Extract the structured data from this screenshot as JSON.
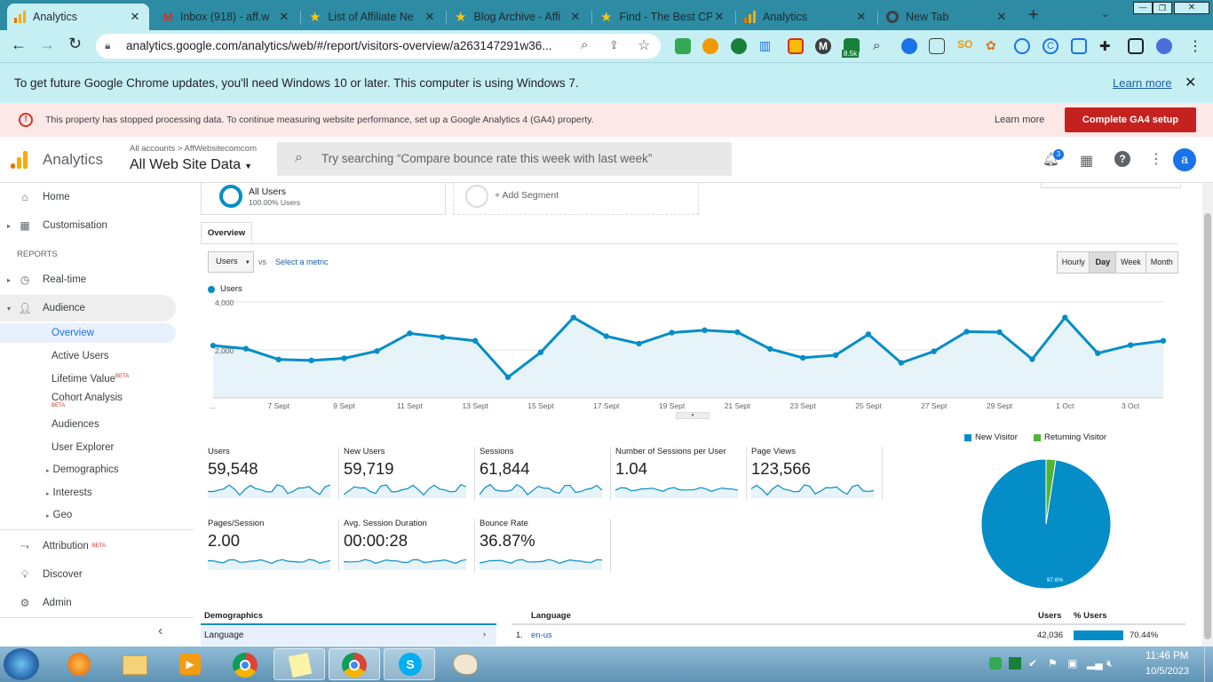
{
  "tabs": [
    {
      "title": "Analytics",
      "icon": "analytics-icon",
      "active": true
    },
    {
      "title": "Inbox (918) - aff.w",
      "icon": "gmail-icon"
    },
    {
      "title": "List of Affiliate Ne",
      "icon": "star-icon"
    },
    {
      "title": "Blog Archive - Affi",
      "icon": "star-icon"
    },
    {
      "title": "Find - The Best CP",
      "icon": "star-icon"
    },
    {
      "title": "Analytics",
      "icon": "analytics-icon"
    },
    {
      "title": "New Tab",
      "icon": "chrome-icon"
    }
  ],
  "tab_close": "✕",
  "new_tab": "+",
  "url": "analytics.google.com/analytics/web/#/report/visitors-overview/a263147291w36...",
  "ext_badge": "8.5k",
  "chrome_banner": {
    "text": "To get future Google Chrome updates, you'll need Windows 10 or later. This computer is using Windows 7.",
    "link": "Learn more",
    "close": "✕"
  },
  "ga_banner": {
    "text": "This property has stopped processing data. To continue measuring website performance, set up a Google Analytics 4 (GA4) property.",
    "learn": "Learn more",
    "cta": "Complete GA4 setup"
  },
  "header": {
    "product": "Analytics",
    "crumb": "All accounts > AffWebsitecomcom",
    "view": "All Web Site Data",
    "search_placeholder": "Try searching “Compare bounce rate this week with last week”",
    "notif_count": "3",
    "avatar": "a"
  },
  "sidebar": {
    "home": "Home",
    "customisation": "Customisation",
    "reports": "REPORTS",
    "realtime": "Real-time",
    "audience": "Audience",
    "sub": [
      "Overview",
      "Active Users",
      "Lifetime Value",
      "Cohort Analysis",
      "Audiences",
      "User Explorer",
      "Demographics",
      "Interests",
      "Geo"
    ],
    "beta": "BETA",
    "attribution": "Attribution",
    "discover": "Discover",
    "admin": "Admin",
    "collapse": "‹"
  },
  "segments": {
    "all_users": "All Users",
    "all_users_pct": "100.00% Users",
    "add": "+ Add Segment"
  },
  "overview_tab": "Overview",
  "metric_select": "Users",
  "vs": "vs",
  "select_metric": "Select a metric",
  "granularity": [
    "Hourly",
    "Day",
    "Week",
    "Month"
  ],
  "legend": "Users",
  "metrics": [
    {
      "label": "Users",
      "value": "59,548"
    },
    {
      "label": "New Users",
      "value": "59,719"
    },
    {
      "label": "Sessions",
      "value": "61,844"
    },
    {
      "label": "Number of Sessions per User",
      "value": "1.04"
    },
    {
      "label": "Page Views",
      "value": "123,566"
    },
    {
      "label": "Pages/Session",
      "value": "2.00"
    },
    {
      "label": "Avg. Session Duration",
      "value": "00:00:28"
    },
    {
      "label": "Bounce Rate",
      "value": "36.87%"
    }
  ],
  "pie": {
    "legend": [
      "New Visitor",
      "Returning Visitor"
    ],
    "label": "97.6%",
    "values": [
      97.6,
      2.4
    ]
  },
  "demographics": {
    "title": "Demographics",
    "item": "Language",
    "col_lang": "Language",
    "col_users": "Users",
    "col_pct": "% Users",
    "row": {
      "idx": "1.",
      "lang": "en-us",
      "users": "42,036",
      "pct": "70.44%"
    }
  },
  "taskbar": {
    "time": "11:46 PM",
    "date": "10/5/2023"
  },
  "chart_data": {
    "type": "line",
    "x": [
      "5 Sept",
      "6 Sept",
      "7 Sept",
      "8 Sept",
      "9 Sept",
      "10 Sept",
      "11 Sept",
      "12 Sept",
      "13 Sept",
      "14 Sept",
      "15 Sept",
      "16 Sept",
      "17 Sept",
      "18 Sept",
      "19 Sept",
      "20 Sept",
      "21 Sept",
      "22 Sept",
      "23 Sept",
      "24 Sept",
      "25 Sept",
      "26 Sept",
      "27 Sept",
      "28 Sept",
      "29 Sept",
      "30 Sept",
      "1 Oct",
      "2 Oct",
      "3 Oct",
      "4 Oct"
    ],
    "tick_labels": [
      "...",
      "7 Sept",
      "9 Sept",
      "11 Sept",
      "13 Sept",
      "15 Sept",
      "17 Sept",
      "19 Sept",
      "21 Sept",
      "23 Sept",
      "25 Sept",
      "27 Sept",
      "29 Sept",
      "1 Oct",
      "3 Oct"
    ],
    "series": [
      {
        "name": "Users",
        "values": [
          2180,
          2050,
          1600,
          1560,
          1650,
          1950,
          2690,
          2530,
          2380,
          860,
          1900,
          3350,
          2570,
          2260,
          2720,
          2820,
          2740,
          2040,
          1670,
          1780,
          2650,
          1460,
          1940,
          2760,
          2740,
          1610,
          3350,
          1860,
          2200,
          2380
        ]
      }
    ],
    "yticks": [
      "2,000",
      "4,000"
    ],
    "ylim": [
      0,
      4000
    ],
    "grid": true
  }
}
